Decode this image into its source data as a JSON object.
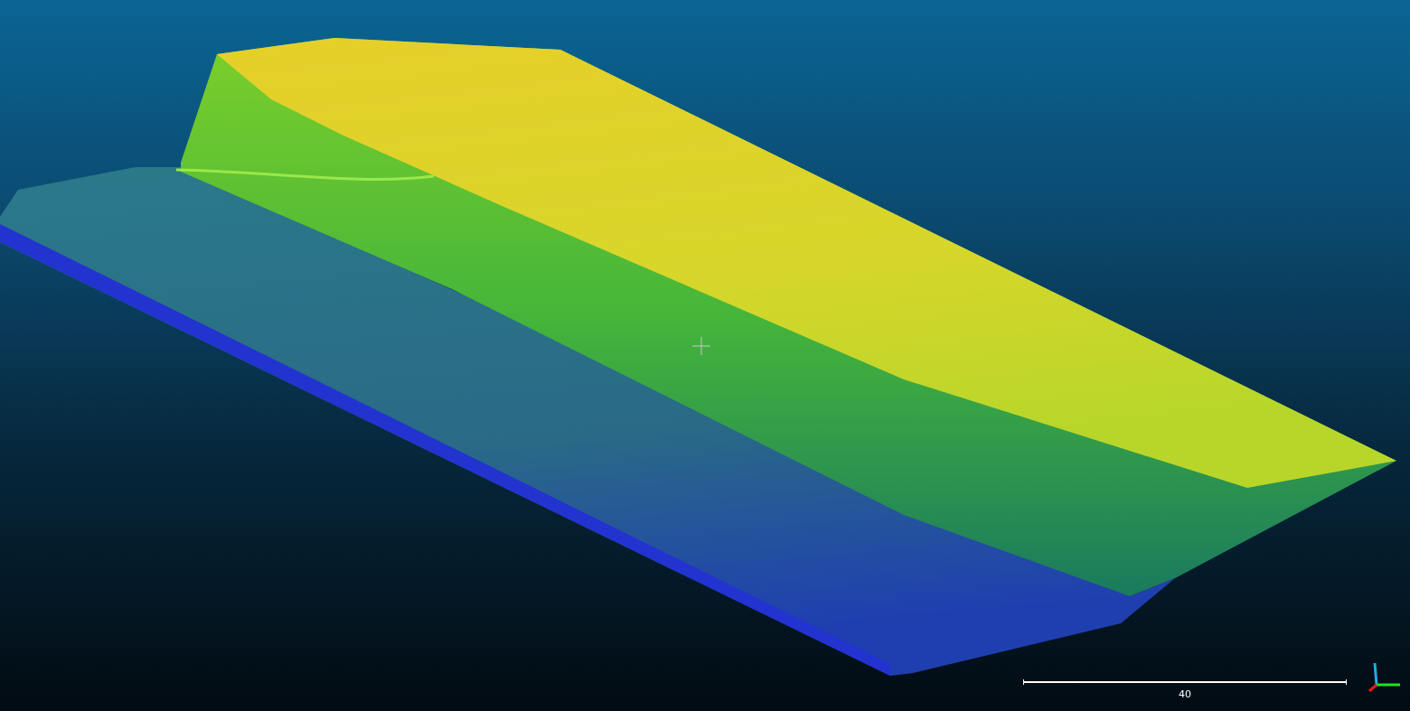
{
  "scale_bar": {
    "label": "40"
  }
}
